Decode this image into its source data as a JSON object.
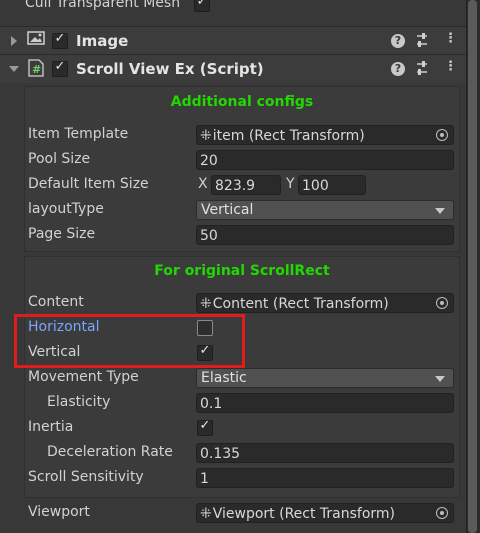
{
  "top_row": {
    "label": "Cull Transparent Mesh",
    "checked": true
  },
  "image_component": {
    "title": "Image",
    "enabled": true,
    "icon": "image-icon"
  },
  "script_component": {
    "title": "Scroll View Ex (Script)",
    "enabled": true,
    "icon": "script-hash-icon"
  },
  "header_icons": [
    "help-icon",
    "preset-icon",
    "kebab-menu-icon"
  ],
  "additional_configs": {
    "heading": "Additional configs",
    "item_template": {
      "label": "Item Template",
      "value": "item (Rect Transform)"
    },
    "pool_size": {
      "label": "Pool Size",
      "value": "20"
    },
    "default_item_size": {
      "label": "Default Item Size",
      "x_label": "X",
      "x": "823.9",
      "y_label": "Y",
      "y": "100"
    },
    "layout_type": {
      "label": "layoutType",
      "value": "Vertical"
    },
    "page_size": {
      "label": "Page Size",
      "value": "50"
    }
  },
  "original_scrollrect": {
    "heading": "For original ScrollRect",
    "content": {
      "label": "Content",
      "value": "Content (Rect Transform)"
    },
    "horizontal": {
      "label": "Horizontal",
      "checked": false
    },
    "vertical": {
      "label": "Vertical",
      "checked": true
    },
    "movement_type": {
      "label": "Movement Type",
      "value": "Elastic"
    },
    "elasticity": {
      "label": "Elasticity",
      "value": "0.1"
    },
    "inertia": {
      "label": "Inertia",
      "checked": true
    },
    "deceleration_rate": {
      "label": "Deceleration Rate",
      "value": "0.135"
    },
    "scroll_sensitivity": {
      "label": "Scroll Sensitivity",
      "value": "1"
    },
    "viewport": {
      "label": "Viewport",
      "value": "Viewport (Rect Transform)"
    }
  },
  "colors": {
    "section_heading": "#21d900",
    "highlight_box": "#e01c1c",
    "focused_label": "#7aa5ff"
  }
}
